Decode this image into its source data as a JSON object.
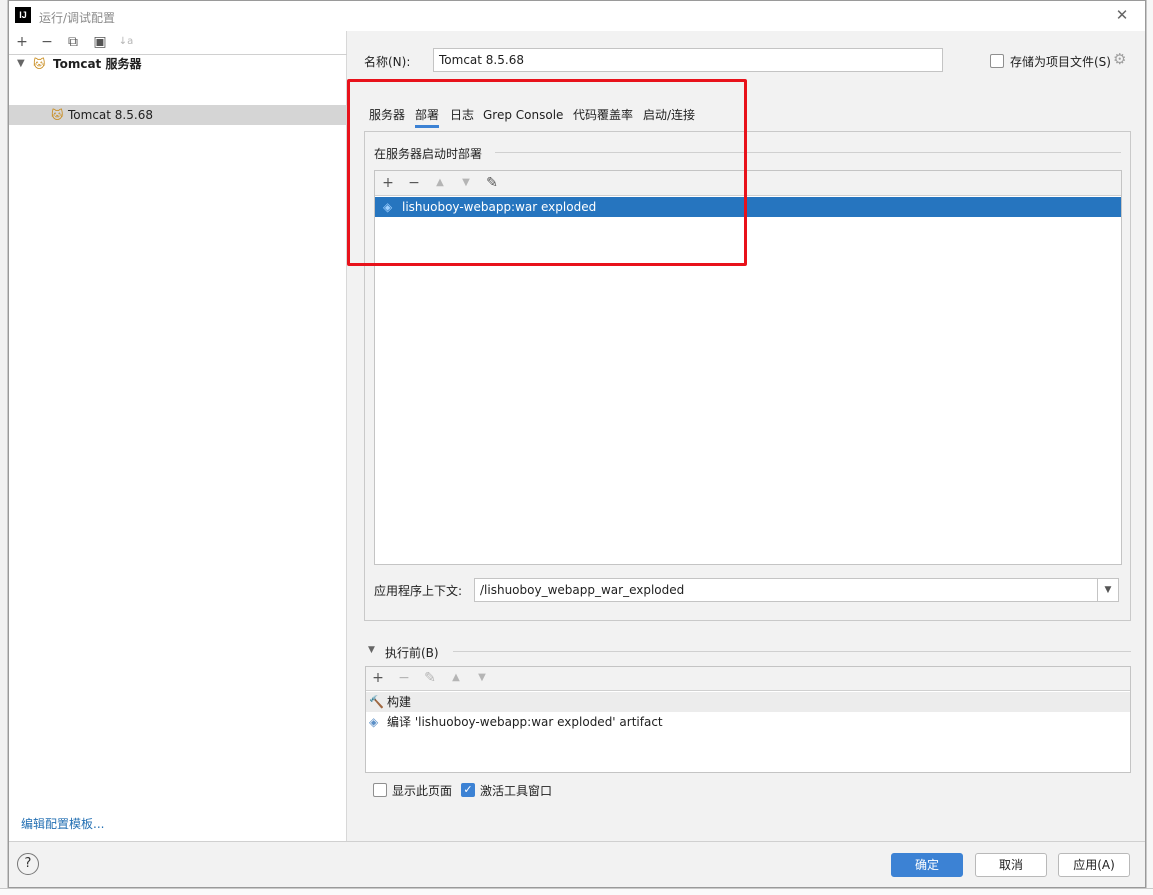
{
  "dialog": {
    "title": "运行/调试配置",
    "app_icon": "IJ"
  },
  "left": {
    "toolbar": [
      "+",
      "−",
      "⧉",
      "▣",
      "↓a"
    ],
    "tree": {
      "group_label": "Tomcat 服务器",
      "child_label": "Tomcat 8.5.68"
    },
    "edit_templates": "编辑配置模板..."
  },
  "form": {
    "name_label": "名称(N):",
    "name_value": "Tomcat 8.5.68",
    "store_label": "存储为项目文件(S)"
  },
  "tabs": [
    "服务器",
    "部署",
    "日志",
    "Grep Console",
    "代码覆盖率",
    "启动/连接"
  ],
  "deploy": {
    "section_label": "在服务器启动时部署",
    "artifact": "lishuoboy-webapp:war exploded",
    "context_label": "应用程序上下文:",
    "context_value": "/lishuoboy_webapp_war_exploded"
  },
  "before": {
    "section_label": "执行前(B)",
    "items": [
      "构建",
      "编译 'lishuoboy-webapp:war exploded' artifact"
    ]
  },
  "options": {
    "show_page": "显示此页面",
    "activate_tool": "激活工具窗口"
  },
  "buttons": {
    "ok": "确定",
    "cancel": "取消",
    "apply": "应用(A)",
    "help": "?"
  },
  "colors": {
    "accent": "#3c82d4",
    "selection": "#2675bf",
    "highlight_box": "#e8121b"
  }
}
